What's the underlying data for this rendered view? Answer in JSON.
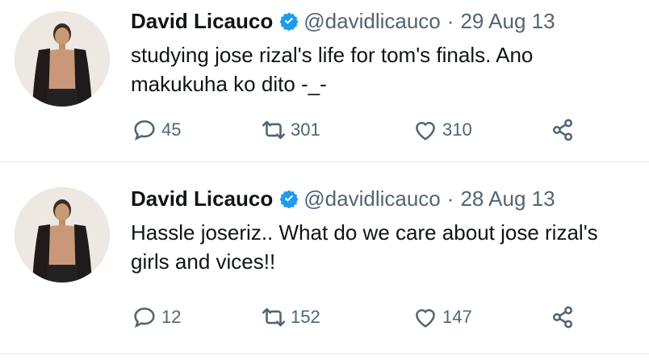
{
  "tweets": [
    {
      "author": "David Licauco",
      "handle": "@davidlicauco",
      "separator": "·",
      "date": "29 Aug 13",
      "text": "studying jose rizal's life for tom's finals. Ano makukuha ko dito -_-",
      "replies": "45",
      "retweets": "301",
      "likes": "310"
    },
    {
      "author": "David Licauco",
      "handle": "@davidlicauco",
      "separator": "·",
      "date": "28 Aug 13",
      "text": "Hassle joseriz.. What do we care about jose rizal's girls and vices!!",
      "replies": "12",
      "retweets": "152",
      "likes": "147"
    }
  ],
  "icons": {
    "verified": "verified-badge-icon",
    "reply": "reply-icon",
    "retweet": "retweet-icon",
    "like": "like-icon",
    "share": "share-icon"
  },
  "colors": {
    "verified": "#1d9bf0",
    "muted": "#536471",
    "text": "#0f1419"
  }
}
